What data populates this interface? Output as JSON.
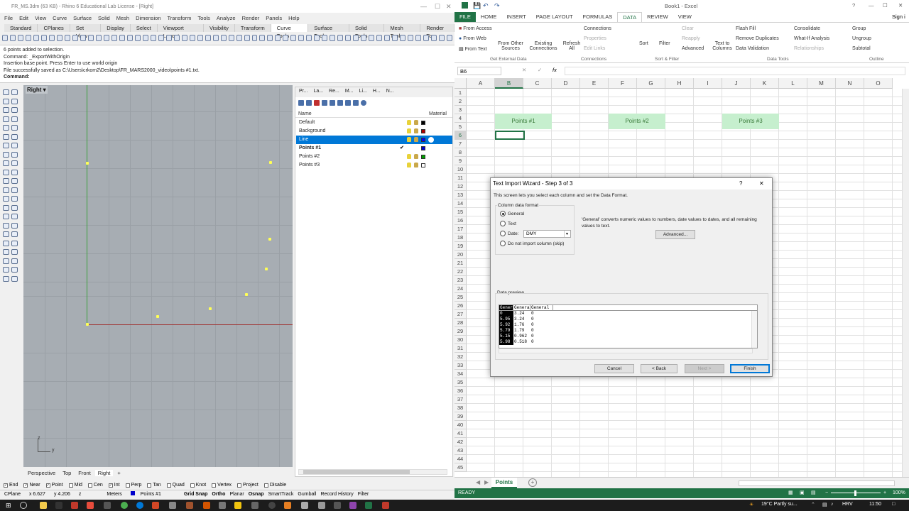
{
  "rhino": {
    "title": "FR_MS.3dm (63 KB) - Rhino 6 Educational Lab License - [Right]",
    "menu": [
      "File",
      "Edit",
      "View",
      "Curve",
      "Surface",
      "Solid",
      "Mesh",
      "Dimension",
      "Transform",
      "Tools",
      "Analyze",
      "Render",
      "Panels",
      "Help"
    ],
    "tabs": [
      "Standard",
      "CPlanes",
      "Set View",
      "Display",
      "Select",
      "Viewport Layout",
      "Visibility",
      "Transform",
      "Curve Tools",
      "Surface Tools",
      "Solid Tools",
      "Mesh Tools",
      "Render Tc"
    ],
    "active_tab": "Curve Tools",
    "command_history": [
      "6 points added to selection.",
      "Command: _ExportWithOrigin",
      "Insertion base point. Press Enter to use world origin",
      "File successfully saved as C:\\Users\\crkom2\\Desktop\\FR_MARS2000_video\\points #1.txt."
    ],
    "command_prompt": "Command:",
    "viewport_label": "Right",
    "viewport_tabs": [
      "Perspective",
      "Top",
      "Front",
      "Right"
    ],
    "active_viewport": "Right",
    "axis_z": "z",
    "axis_y": "y",
    "layer_panel_tabs": [
      "Pr...",
      "La...",
      "Re...",
      "M...",
      "Li...",
      "H...",
      "N..."
    ],
    "layer_header_name": "Name",
    "layer_header_material": "Material",
    "layers": [
      {
        "name": "Default",
        "color": "#000000",
        "selected": false,
        "current": false
      },
      {
        "name": "Background",
        "color": "#b00000",
        "selected": false,
        "current": false
      },
      {
        "name": "Line",
        "color": "#0000ff",
        "selected": true,
        "current": false
      },
      {
        "name": "Points #1",
        "color": "#0000cc",
        "selected": false,
        "current": true
      },
      {
        "name": "Points #2",
        "color": "#00a000",
        "selected": false,
        "current": false
      },
      {
        "name": "Points #3",
        "color": "#ffffff",
        "selected": false,
        "current": false
      }
    ],
    "osnaps": [
      {
        "label": "End",
        "checked": true
      },
      {
        "label": "Near",
        "checked": true
      },
      {
        "label": "Point",
        "checked": true
      },
      {
        "label": "Mid",
        "checked": false
      },
      {
        "label": "Cen",
        "checked": false
      },
      {
        "label": "Int",
        "checked": true
      },
      {
        "label": "Perp",
        "checked": false
      },
      {
        "label": "Tan",
        "checked": false
      },
      {
        "label": "Quad",
        "checked": false
      },
      {
        "label": "Knot",
        "checked": false
      },
      {
        "label": "Vertex",
        "checked": false
      },
      {
        "label": "Project",
        "checked": false
      },
      {
        "label": "Disable",
        "checked": false
      }
    ],
    "status": {
      "cplane": "CPlane",
      "x": "x 6.627",
      "y": "y 4.206",
      "z": "z",
      "units": "Meters",
      "layer": "Points #1",
      "toggles": [
        "Grid Snap",
        "Ortho",
        "Planar",
        "Osnap",
        "SmartTrack",
        "Gumball",
        "Record History",
        "Filter"
      ]
    }
  },
  "excel": {
    "title": "Book1 - Excel",
    "sign_in": "Sign i",
    "tabs": [
      "FILE",
      "HOME",
      "INSERT",
      "PAGE LAYOUT",
      "FORMULAS",
      "DATA",
      "REVIEW",
      "VIEW"
    ],
    "active_tab": "DATA",
    "ribbon": {
      "from_access": "From Access",
      "from_web": "From Web",
      "from_text": "From Text",
      "from_other": "From Other Sources",
      "existing": "Existing Connections",
      "refresh": "Refresh All",
      "connections": "Connections",
      "properties": "Properties",
      "edit_links": "Edit Links",
      "sort": "Sort",
      "filter": "Filter",
      "clear": "Clear",
      "reapply": "Reapply",
      "advanced": "Advanced",
      "text_to_columns": "Text to Columns",
      "flash_fill": "Flash Fill",
      "remove_duplicates": "Remove Duplicates",
      "data_validation": "Data Validation",
      "consolidate": "Consolidate",
      "what_if": "What-If Analysis",
      "relationships": "Relationships",
      "group": "Group",
      "ungroup": "Ungroup",
      "subtotal": "Subtotal",
      "grp_external": "Get External Data",
      "grp_connections": "Connections",
      "grp_sort": "Sort & Filter",
      "grp_tools": "Data Tools",
      "grp_outline": "Outline"
    },
    "name_box": "B6",
    "fx": "fx",
    "columns": [
      "A",
      "B",
      "C",
      "D",
      "E",
      "F",
      "G",
      "H",
      "I",
      "J",
      "K",
      "L",
      "M",
      "N",
      "O"
    ],
    "selected_col": "B",
    "selected_row": 6,
    "rows": [
      1,
      2,
      3,
      4,
      5,
      6,
      7,
      8,
      9,
      10,
      11,
      12,
      13,
      14,
      15,
      16,
      17,
      18,
      19,
      20,
      21,
      22,
      23,
      24,
      25,
      26,
      27,
      28,
      29,
      30,
      31,
      32,
      33,
      34,
      35,
      36,
      37,
      38,
      39,
      40,
      41,
      42,
      43,
      44,
      45
    ],
    "point_headers": [
      "Points #1",
      "Points #2",
      "Points #3"
    ],
    "sheet_tab": "Points",
    "status_ready": "READY",
    "zoom": "100%"
  },
  "dialog": {
    "title": "Text Import Wizard - Step 3 of 3",
    "help": "?",
    "close": "✕",
    "intro": "This screen lets you select each column and set the Data Format.",
    "column_format_label": "Column data format",
    "options": [
      "General",
      "Text",
      "Date:",
      "Do not import column (skip)"
    ],
    "selected_option": "General",
    "date_format": "DMY",
    "general_note": "'General' converts numeric values to numbers, date values to dates, and all remaining values to text.",
    "advanced_btn": "Advanced...",
    "preview_label": "Data preview",
    "preview_header": [
      "Gener",
      "Genera",
      "General"
    ],
    "preview_rows": [
      [
        "0",
        "3.24",
        "0"
      ],
      [
        "5.95",
        "3.24",
        "0"
      ],
      [
        "5.92",
        "1.76",
        "0"
      ],
      [
        "5.79",
        "1.79",
        "0"
      ],
      [
        "5.15",
        "0.962",
        "0"
      ],
      [
        "5.98",
        "0.518",
        "0"
      ]
    ],
    "buttons": {
      "cancel": "Cancel",
      "back": "< Back",
      "next": "Next >",
      "finish": "Finish"
    }
  },
  "taskbar": {
    "weather": "19°C  Partly su...",
    "lang": "HRV",
    "time": "11:50"
  }
}
